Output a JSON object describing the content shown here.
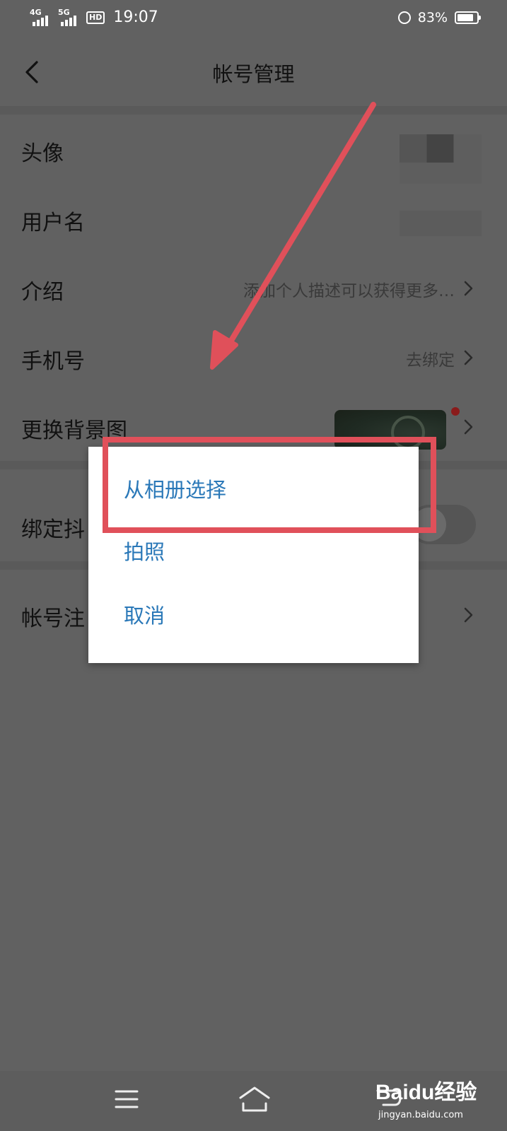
{
  "status_bar": {
    "signal1_label": "4G",
    "signal2_label": "5G",
    "hd_label": "HD",
    "time": "19:07",
    "battery_percent": "83%",
    "battery_level": 0.83
  },
  "header": {
    "title": "帐号管理"
  },
  "rows": [
    {
      "label": "头像",
      "value": ""
    },
    {
      "label": "用户名",
      "value": ""
    },
    {
      "label": "介绍",
      "value": "添加个人描述可以获得更多…"
    },
    {
      "label": "手机号",
      "value": "去绑定"
    },
    {
      "label": "更换背景图",
      "value": ""
    },
    {
      "label": "绑定抖",
      "value": ""
    },
    {
      "label": "帐号注",
      "value": ""
    }
  ],
  "dialog": {
    "options": [
      "从相册选择",
      "拍照",
      "取消"
    ]
  },
  "watermark": {
    "brand": "Baidu经验",
    "url": "jingyan.baidu.com"
  },
  "colors": {
    "annotation": "#e0505a",
    "option_text": "#2a78b8",
    "dim_background": "#616161"
  }
}
